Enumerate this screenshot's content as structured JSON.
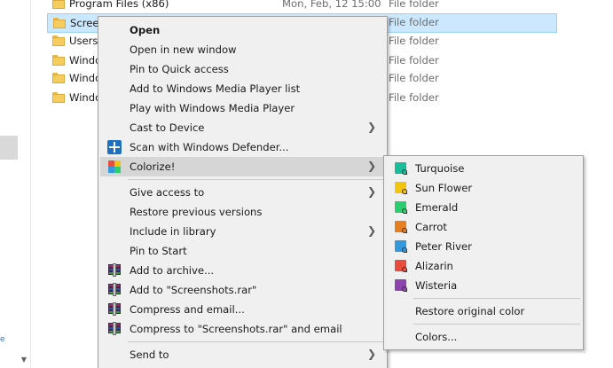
{
  "files": [
    {
      "name": "Program Files (x86)",
      "date": "Mon, Feb, 12 15:00",
      "type": "File folder",
      "selected": false
    },
    {
      "name": "Screen",
      "date": "",
      "type": "File folder",
      "selected": true
    },
    {
      "name": "Users",
      "date": "",
      "type": "File folder",
      "selected": false
    },
    {
      "name": "Windo",
      "date": "",
      "type": "File folder",
      "selected": false
    },
    {
      "name": "Windo",
      "date": "",
      "type": "File folder",
      "selected": false
    },
    {
      "name": "Windo",
      "date": "",
      "type": "File folder",
      "selected": false
    }
  ],
  "context_menu": {
    "open": "Open",
    "open_new_window": "Open in new window",
    "pin_quick_access": "Pin to Quick access",
    "add_wmp_list": "Add to Windows Media Player list",
    "play_wmp": "Play with Windows Media Player",
    "cast_to_device": "Cast to Device",
    "scan_defender": "Scan with Windows Defender...",
    "colorize": "Colorize!",
    "give_access": "Give access to",
    "restore_versions": "Restore previous versions",
    "include_library": "Include in library",
    "pin_start": "Pin to Start",
    "add_archive": "Add to archive...",
    "add_rar": "Add to \"Screenshots.rar\"",
    "compress_email": "Compress and email...",
    "compress_rar_email": "Compress to \"Screenshots.rar\" and email",
    "send_to": "Send to"
  },
  "colorize_submenu": {
    "colors": [
      {
        "label": "Turquoise",
        "color": "#1abc9c"
      },
      {
        "label": "Sun Flower",
        "color": "#f1c40f"
      },
      {
        "label": "Emerald",
        "color": "#2ecc71"
      },
      {
        "label": "Carrot",
        "color": "#e67e22"
      },
      {
        "label": "Peter River",
        "color": "#3498db"
      },
      {
        "label": "Alizarin",
        "color": "#e74c3c"
      },
      {
        "label": "Wisteria",
        "color": "#8e44ad"
      }
    ],
    "restore": "Restore original color",
    "more_colors": "Colors..."
  }
}
